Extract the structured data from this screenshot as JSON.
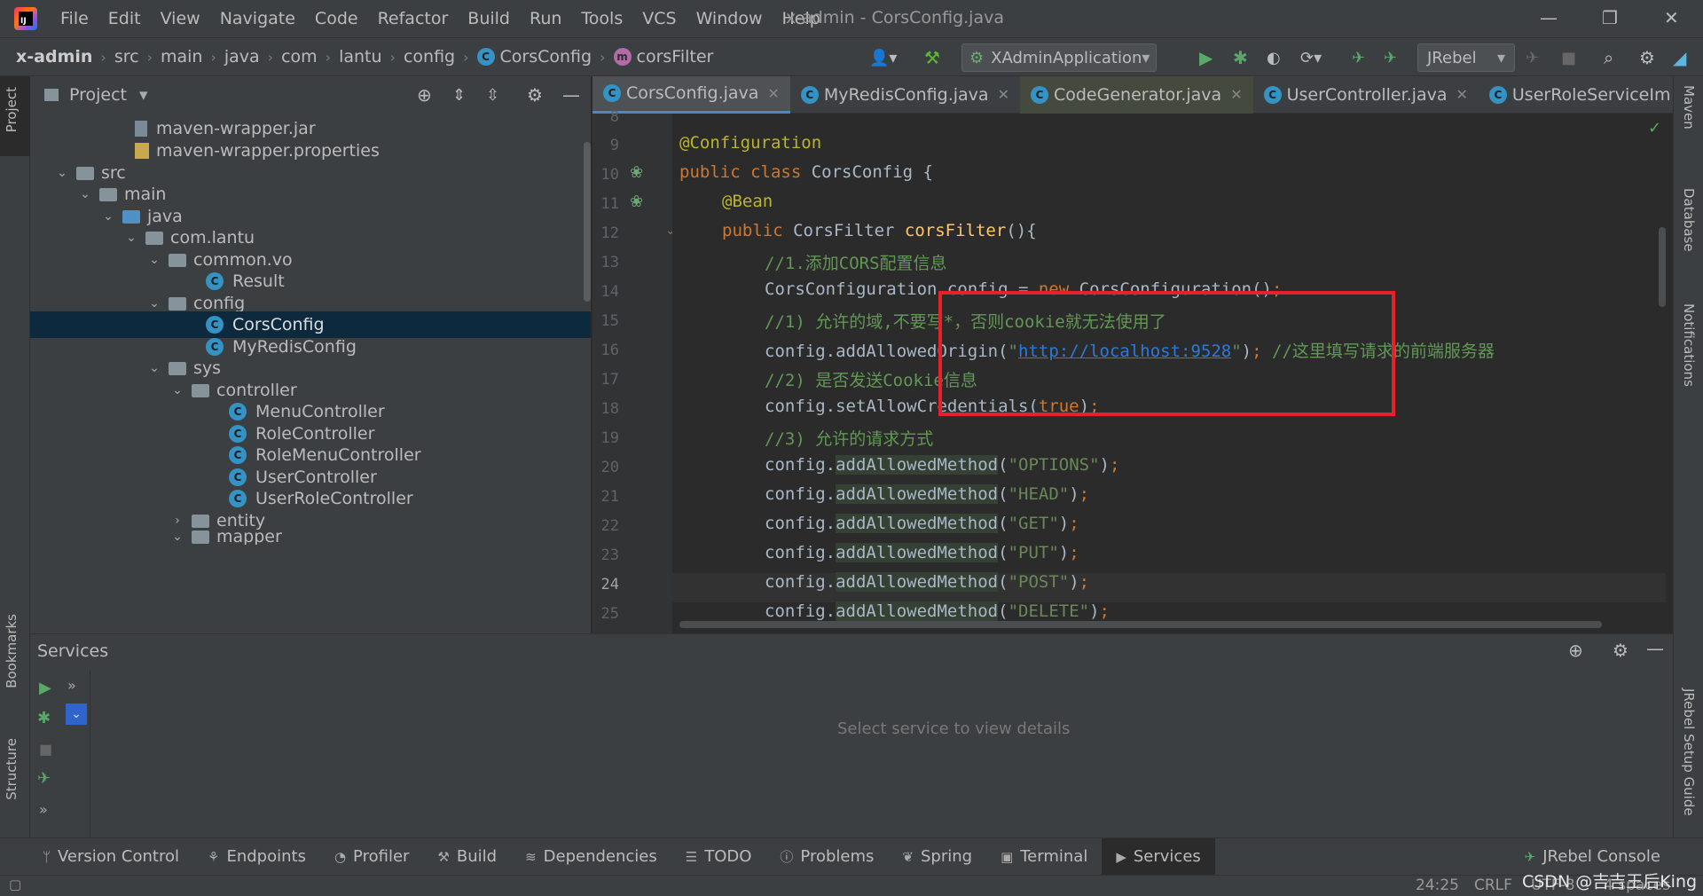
{
  "window": {
    "title": "x-admin - CorsConfig.java"
  },
  "menu": [
    "File",
    "Edit",
    "View",
    "Navigate",
    "Code",
    "Refactor",
    "Build",
    "Run",
    "Tools",
    "VCS",
    "Window",
    "Help"
  ],
  "breadcrumb": [
    "x-admin",
    "src",
    "main",
    "java",
    "com",
    "lantu",
    "config",
    "CorsConfig",
    "corsFilter"
  ],
  "toolbar": {
    "run_config": "XAdminApplication",
    "jrebel": "JRebel"
  },
  "left_strip": {
    "project": "Project",
    "bookmarks": "Bookmarks",
    "structure": "Structure"
  },
  "right_strip": {
    "maven": "Maven",
    "database": "Database",
    "notifications": "Notifications",
    "jrebel_guide": "JRebel Setup Guide"
  },
  "project": {
    "title": "Project",
    "tree": [
      {
        "label": "maven-wrapper.jar"
      },
      {
        "label": "maven-wrapper.properties"
      },
      {
        "label": "src"
      },
      {
        "label": "main"
      },
      {
        "label": "java"
      },
      {
        "label": "com.lantu"
      },
      {
        "label": "common.vo"
      },
      {
        "label": "Result"
      },
      {
        "label": "config"
      },
      {
        "label": "CorsConfig"
      },
      {
        "label": "MyRedisConfig"
      },
      {
        "label": "sys"
      },
      {
        "label": "controller"
      },
      {
        "label": "MenuController"
      },
      {
        "label": "RoleController"
      },
      {
        "label": "RoleMenuController"
      },
      {
        "label": "UserController"
      },
      {
        "label": "UserRoleController"
      },
      {
        "label": "entity"
      },
      {
        "label": "mapper"
      }
    ]
  },
  "editor_tabs": [
    "CorsConfig.java",
    "MyRedisConfig.java",
    "CodeGenerator.java",
    "UserController.java",
    "UserRoleServiceIm"
  ],
  "code": {
    "line_numbers": [
      "8",
      "9",
      "10",
      "11",
      "12",
      "13",
      "14",
      "15",
      "16",
      "17",
      "18",
      "19",
      "20",
      "21",
      "22",
      "23",
      "24",
      "25"
    ],
    "l9": "@Configuration",
    "l10_kw": "public class ",
    "l10_rest": "CorsConfig {",
    "l11": "@Bean",
    "l12_kw": "public ",
    "l12_type": "CorsFilter ",
    "l12_fn": "corsFilter",
    "l12_rest": "(){",
    "l13": "//1.添加CORS配置信息",
    "l14_a": "CorsConfiguration config = ",
    "l14_kw": "new ",
    "l14_b": "CorsConfiguration()",
    "l14_semi": ";",
    "l15": "//1) 允许的域,不要写*，否则cookie就无法使用了",
    "l16_a": "config.addAllowedOrigin(",
    "l16_q1": "\"",
    "l16_url": "http://localhost:9528",
    "l16_q2": "\"",
    "l16_b": ")",
    "l16_semi": "; ",
    "l16_cm": "//这里填写请求的前端服务器",
    "l17": "//2) 是否发送Cookie信息",
    "l18_a": "config.setAllowCredentials(",
    "l18_kw": "true",
    "l18_b": ")",
    "l18_semi": ";",
    "l19": "//3) 允许的请求方式",
    "m_prefix": "config.",
    "m_name": "addAllowedMethod",
    "m20": "\"OPTIONS\"",
    "m21": "\"HEAD\"",
    "m22": "\"GET\"",
    "m23": "\"PUT\"",
    "m24": "\"POST\"",
    "m25": "\"DELETE\"",
    "paren_open": "(",
    "paren_close": ")",
    "semi": ";"
  },
  "services": {
    "title": "Services",
    "empty_text": "Select service to view details"
  },
  "bottom_tabs": [
    "Version Control",
    "Endpoints",
    "Profiler",
    "Build",
    "Dependencies",
    "TODO",
    "Problems",
    "Spring",
    "Terminal",
    "Services"
  ],
  "bottom_right": "JRebel Console",
  "status": {
    "position": "24:25",
    "line_sep": "CRLF",
    "encoding": "UTF-8",
    "indent": "4 spaces",
    "watermark": "CSDN @吉吉王后King"
  }
}
